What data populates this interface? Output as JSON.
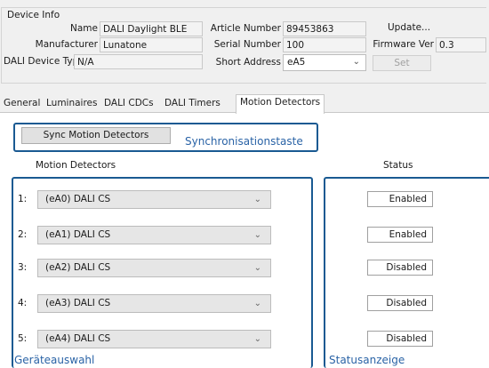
{
  "device_info": {
    "title": "Device Info",
    "name_label": "Name",
    "name_value": "DALI Daylight BLE",
    "manufacturer_label": "Manufacturer",
    "manufacturer_value": "Lunatone",
    "device_type_label": "DALI Device Type",
    "device_type_value": "N/A",
    "article_label": "Article Number",
    "article_value": "89453863",
    "serial_label": "Serial Number",
    "serial_value": "100",
    "short_address_label": "Short Address",
    "short_address_value": "eA5",
    "update_label": "Update...",
    "firmware_label": "Firmware Ver",
    "firmware_value": "0.3",
    "set_label": "Set"
  },
  "tabs": [
    {
      "label": "General"
    },
    {
      "label": "Luminaires"
    },
    {
      "label": "DALI CDCs"
    },
    {
      "label": "DALI Timers"
    },
    {
      "label": "Motion Detectors",
      "active": true
    }
  ],
  "motion": {
    "sync_button": "Sync Motion Detectors",
    "column_detectors": "Motion Detectors",
    "column_status": "Status",
    "rows": [
      {
        "num": "1:",
        "device": "(eA0) DALI CS",
        "status": "Enabled"
      },
      {
        "num": "2:",
        "device": "(eA1) DALI CS",
        "status": "Enabled"
      },
      {
        "num": "3:",
        "device": "(eA2) DALI CS",
        "status": "Disabled"
      },
      {
        "num": "4:",
        "device": "(eA3) DALI CS",
        "status": "Disabled"
      },
      {
        "num": "5:",
        "device": "(eA4) DALI CS",
        "status": "Disabled"
      }
    ]
  },
  "annotations": {
    "sync": "Synchronisationstaste",
    "device_select": "Geräteauswahl",
    "status_display": "Statusanzeige"
  },
  "colors": {
    "highlight": "#1a5a92",
    "annotation_text": "#2a63a6"
  }
}
